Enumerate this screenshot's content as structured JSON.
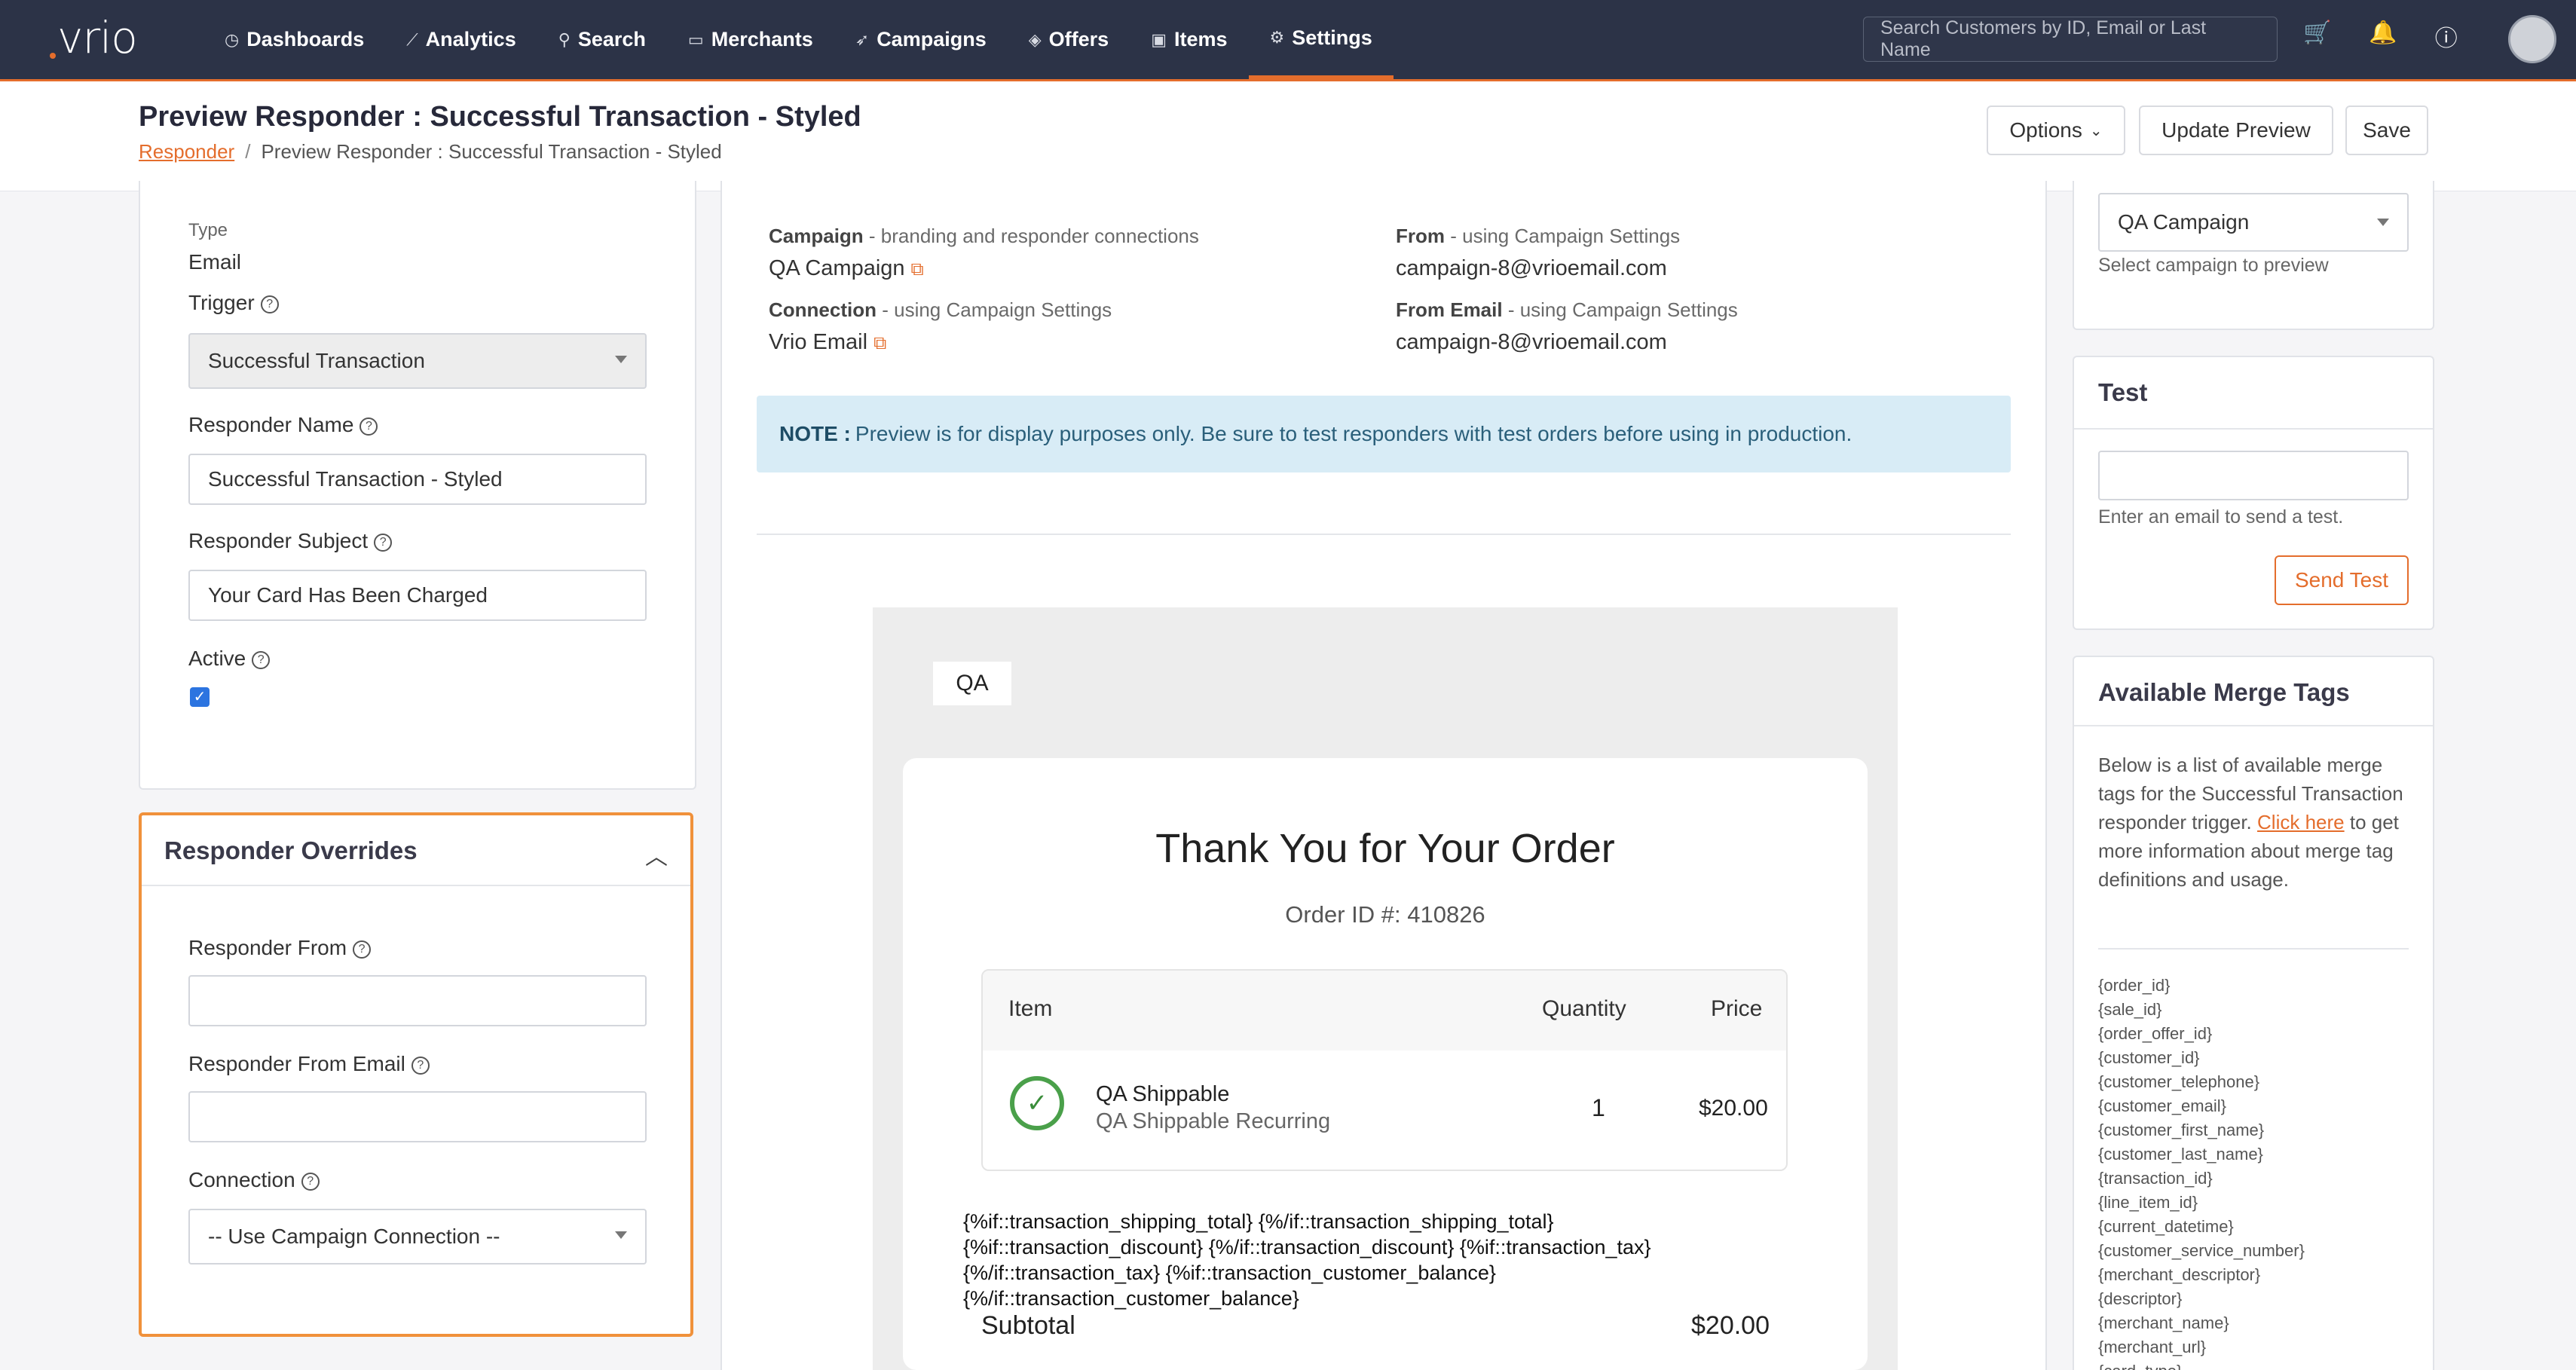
{
  "nav": {
    "logo": "vrio",
    "items": [
      {
        "label": "Dashboards",
        "icon": "dashboard-icon"
      },
      {
        "label": "Analytics",
        "icon": "chart-icon"
      },
      {
        "label": "Search",
        "icon": "search-icon"
      },
      {
        "label": "Merchants",
        "icon": "card-icon"
      },
      {
        "label": "Campaigns",
        "icon": "megaphone-icon"
      },
      {
        "label": "Offers",
        "icon": "layers-icon"
      },
      {
        "label": "Items",
        "icon": "box-icon"
      },
      {
        "label": "Settings",
        "icon": "gear-icon"
      }
    ],
    "active": "Settings",
    "search_placeholder": "Search Customers by ID, Email or Last Name"
  },
  "header": {
    "title": "Preview Responder : Successful Transaction - Styled",
    "breadcrumb_link": "Responder",
    "breadcrumb_sep": "/",
    "breadcrumb_current": "Preview Responder : Successful Transaction - Styled",
    "options_label": "Options",
    "update_label": "Update Preview",
    "save_label": "Save"
  },
  "left": {
    "type_label": "Type",
    "type_value": "Email",
    "trigger_label": "Trigger",
    "trigger_value": "Successful Transaction",
    "name_label": "Responder Name",
    "name_value": "Successful Transaction - Styled",
    "subject_label": "Responder Subject",
    "subject_value": "Your Card Has Been Charged",
    "active_label": "Active",
    "active_checked": true,
    "overrides_title": "Responder Overrides",
    "from_label": "Responder From",
    "from_value": "",
    "from_email_label": "Responder From Email",
    "from_email_value": "",
    "connection_label": "Connection",
    "connection_value": "-- Use Campaign Connection --"
  },
  "middle": {
    "campaign_label": "Campaign",
    "campaign_desc": " - branding and responder connections",
    "campaign_value": "QA Campaign",
    "from_label": "From",
    "from_desc": " - using Campaign Settings",
    "from_value": "campaign-8@vrioemail.com",
    "connection_label": "Connection",
    "connection_desc": " - using Campaign Settings",
    "connection_value": "Vrio Email",
    "from_email_label": "From Email",
    "from_email_desc": " - using Campaign Settings",
    "from_email_value": "campaign-8@vrioemail.com",
    "note_label": "NOTE :",
    "note_text": "Preview is for display purposes only. Be sure to test responders with test orders before using in production."
  },
  "email": {
    "logo_text": "QA",
    "heading": "Thank You for Your Order",
    "order_id": "Order ID #: 410826",
    "col_item": "Item",
    "col_qty": "Quantity",
    "col_price": "Price",
    "product_name": "QA Shippable",
    "product_sub": "QA Shippable Recurring",
    "product_qty": "1",
    "product_price": "$20.00",
    "merge_lines": [
      "{%if::transaction_shipping_total} {%/if::transaction_shipping_total}",
      "{%if::transaction_discount} {%/if::transaction_discount} {%if::transaction_tax}",
      "{%/if::transaction_tax} {%if::transaction_customer_balance}",
      "{%/if::transaction_customer_balance}"
    ],
    "subtotal_label": "Subtotal",
    "subtotal_value": "$20.00"
  },
  "right": {
    "campaign_value": "QA Campaign",
    "campaign_help": "Select campaign to preview",
    "test_title": "Test",
    "test_value": "",
    "test_help": "Enter an email to send a test.",
    "send_label": "Send Test",
    "merge_title": "Available Merge Tags",
    "merge_desc_1": "Below is a list of available merge tags for the Successful Transaction responder trigger.",
    "merge_link": "Click here",
    "merge_desc_2": " to get more information about merge tag definitions and usage.",
    "tags": [
      "{order_id}",
      "{sale_id}",
      "{order_offer_id}",
      "{customer_id}",
      "{customer_telephone}",
      "{customer_email}",
      "{customer_first_name}",
      "{customer_last_name}",
      "{transaction_id}",
      "{line_item_id}",
      "{current_datetime}",
      "{customer_service_number}",
      "{merchant_descriptor}",
      "{descriptor}",
      "{merchant_name}",
      "{merchant_url}",
      "{card_type}"
    ]
  },
  "colors": {
    "nav_bg": "#2c3347",
    "accent": "#e46d2c",
    "note_bg": "#d8ecf6"
  }
}
